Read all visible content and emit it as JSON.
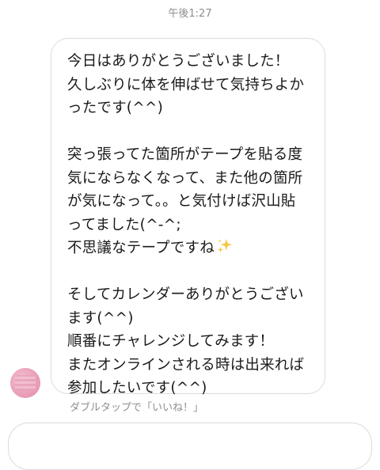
{
  "timestamp": "午後1:27",
  "message": {
    "lines": [
      "今日はありがとうございました！",
      "久しぶりに体を伸ばせて気持ちよか",
      "ったです(^^)",
      "",
      "突っ張ってた箇所がテープを貼る度",
      "気にならなくなって、また他の箇所",
      "が気になって。。と気付けば沢山貼",
      "ってました(^-^;",
      "不思議なテープですね",
      "",
      "そしてカレンダーありがとうござい",
      "ます(^^)",
      "順番にチャレンジしてみます！",
      "またオンラインされる時は出来れば",
      "参加したいです(^^)"
    ],
    "emoji": "sparkles-icon"
  },
  "hint": "ダブルタップで「いいね！」",
  "colors": {
    "bubble_border": "#dcdcdc",
    "meta_text": "#8e8e8e",
    "sparkle": "#f5c542",
    "avatar": "#eaa0b8"
  }
}
